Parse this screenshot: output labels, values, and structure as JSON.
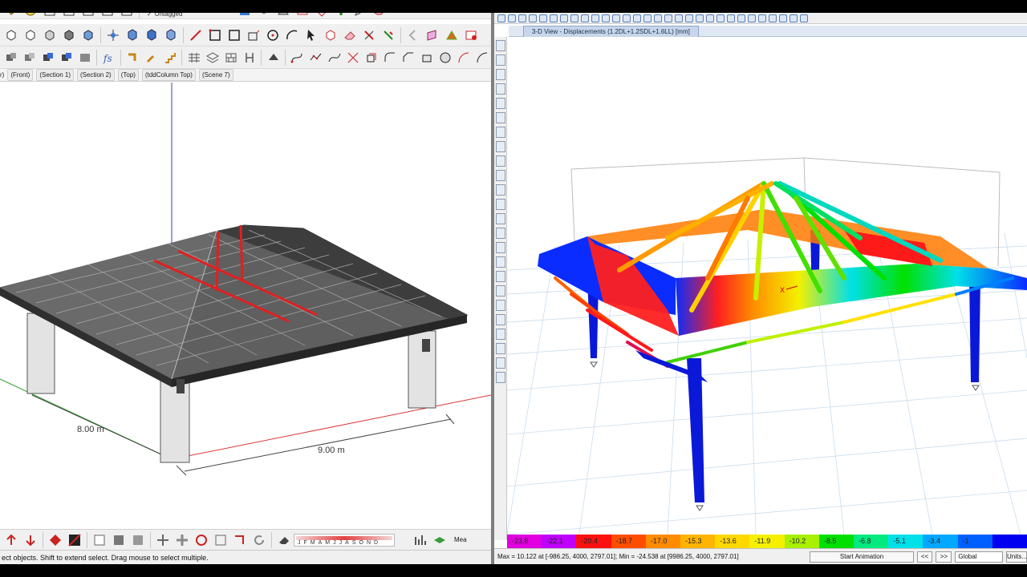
{
  "left": {
    "tag_value": "Untagged",
    "scene_tabs": [
      "(Front)",
      "(Section 1)",
      "(Section 2)",
      "(Top)",
      "(tddColumn Top)",
      "(Scene 7)"
    ],
    "scene_tab_first": "r)",
    "dimension_1": "8.00 m",
    "dimension_2": "9.00 m",
    "months": [
      "J",
      "F",
      "M",
      "A",
      "M",
      "J",
      "J",
      "A",
      "S",
      "O",
      "N",
      "D"
    ],
    "measure_label": "Mea",
    "status_text": "ect objects. Shift to extend select. Drag mouse to select multiple."
  },
  "right": {
    "view_title": "3-D View  - Displacements (1.2DL+1.2SDL+1.6LL)  [mm]",
    "axis_label": "X",
    "legend": [
      {
        "value": "-23.8",
        "color": "#e000e0"
      },
      {
        "value": "-22.1",
        "color": "#c000ff"
      },
      {
        "value": "-20.4",
        "color": "#ff1010"
      },
      {
        "value": "-18.7",
        "color": "#ff4d00"
      },
      {
        "value": "-17.0",
        "color": "#ff8c00"
      },
      {
        "value": "-15.3",
        "color": "#ffb400"
      },
      {
        "value": "-13.6",
        "color": "#ffd800"
      },
      {
        "value": "-11.9",
        "color": "#f4f000"
      },
      {
        "value": "-10.2",
        "color": "#a8f000"
      },
      {
        "value": "-8.5",
        "color": "#00e000"
      },
      {
        "value": "-6.8",
        "color": "#00ea80"
      },
      {
        "value": "-5.1",
        "color": "#00e0e8"
      },
      {
        "value": "-3.4",
        "color": "#00a8ff"
      },
      {
        "value": "-1",
        "color": "#0060ff"
      },
      {
        "value": "",
        "color": "#0000f0"
      }
    ],
    "status_text": "Max = 10.122 at [-986.25, 4000, 2797.01];  Min = -24.538 at [9986.25, 4000, 2797.01]",
    "animation_button": "Start Animation",
    "prev_button": "<<",
    "next_button": ">>",
    "coord_system": "Global",
    "units_button": "Units..."
  },
  "colors": {
    "roof_fill": "#5f5f5f",
    "red_member": "#e02020",
    "column_blue": "#0a18d8",
    "grid_line": "#c9dcee"
  }
}
